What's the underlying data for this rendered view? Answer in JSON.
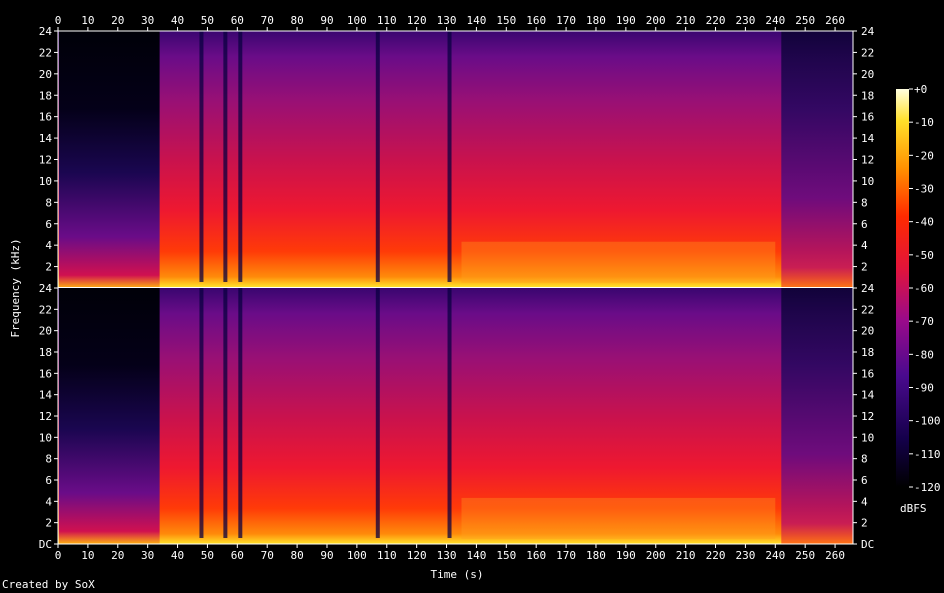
{
  "chart_data": {
    "type": "heatmap",
    "subtype": "spectrogram",
    "channels": 2,
    "xlabel": "Time (s)",
    "ylabel": "Frequency (kHz)",
    "xlim": [
      0,
      266
    ],
    "x_ticks": [
      0,
      10,
      20,
      30,
      40,
      50,
      60,
      70,
      80,
      90,
      100,
      110,
      120,
      130,
      140,
      150,
      160,
      170,
      180,
      190,
      200,
      210,
      220,
      230,
      240,
      250,
      260
    ],
    "ylim_khz": [
      0,
      24
    ],
    "y_tick_labels": [
      "DC",
      "2",
      "4",
      "6",
      "8",
      "10",
      "12",
      "14",
      "16",
      "18",
      "20",
      "22",
      "24"
    ],
    "colorbar": {
      "label": "dBFS",
      "range": [
        -120,
        0
      ],
      "tick_labels": [
        "+0",
        "-10",
        "-20",
        "-30",
        "-40",
        "-50",
        "-60",
        "-70",
        "-80",
        "-90",
        "-100",
        "-110",
        "-120"
      ]
    },
    "features": {
      "quiet_intro_end_s": 34,
      "loud_section_start_s": 34,
      "brief_dip_s": [
        48,
        56,
        61,
        107,
        131
      ],
      "dense_section_s": [
        135,
        240
      ],
      "fade_out_start_s": 240,
      "end_s": 266
    }
  },
  "footer": {
    "credit": "Created by SoX"
  }
}
